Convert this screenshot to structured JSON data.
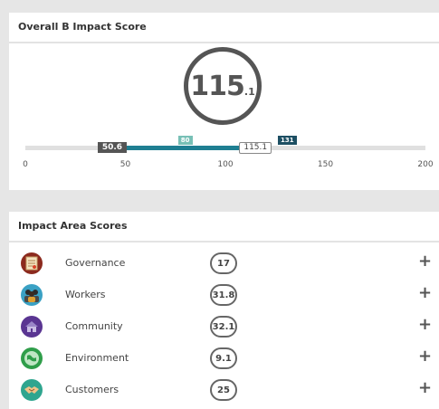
{
  "overall": {
    "title": "Overall B Impact Score",
    "score_whole": "115",
    "score_decimal": ".1",
    "bar": {
      "min": 0,
      "max": 200,
      "fill_start": 50.6,
      "fill_end": 115.1,
      "low_label": "50.6",
      "current_label": "115.1",
      "median_label": "80",
      "top_label": "131"
    },
    "ticks": [
      "0",
      "50",
      "100",
      "150",
      "200"
    ],
    "colors": {
      "fill": "#1f7f92",
      "median": "#78c0b6",
      "top": "#1d4f63"
    }
  },
  "impact": {
    "title": "Impact Area Scores",
    "areas": [
      {
        "name": "Governance",
        "score": "17",
        "icon": "governance-document-icon",
        "color": "#8c2a1e"
      },
      {
        "name": "Workers",
        "score": "31.8",
        "icon": "workers-people-icon",
        "color": "#3aa1c4"
      },
      {
        "name": "Community",
        "score": "32.1",
        "icon": "community-house-icon",
        "color": "#5a3592"
      },
      {
        "name": "Environment",
        "score": "9.1",
        "icon": "environment-globe-icon",
        "color": "#2f9e4a"
      },
      {
        "name": "Customers",
        "score": "25",
        "icon": "customers-handshake-icon",
        "color": "#2fa58f"
      }
    ],
    "expand_symbol": "+"
  }
}
